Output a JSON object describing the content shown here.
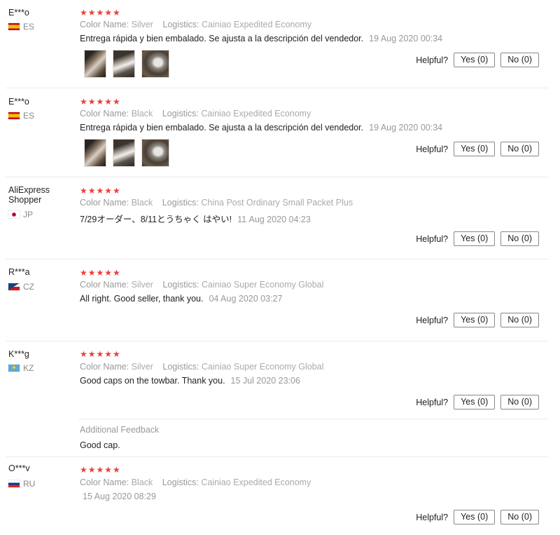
{
  "reviews": [
    {
      "name": "E***o",
      "country": "ES",
      "stars": "★★★★★",
      "color_key": "Color Name:",
      "color_val": "Silver",
      "log_key": "Logistics:",
      "log_val": "Cainiao Expedited Economy",
      "text": "Entrega rápida y bien embalado. Se ajusta a la descripción del vendedor.",
      "date": "19 Aug 2020 00:34",
      "helpful": "Helpful?",
      "yes": "Yes (0)",
      "no": "No (0)"
    },
    {
      "name": "E***o",
      "country": "ES",
      "stars": "★★★★★",
      "color_key": "Color Name:",
      "color_val": "Black",
      "log_key": "Logistics:",
      "log_val": "Cainiao Expedited Economy",
      "text": "Entrega rápida y bien embalado. Se ajusta a la descripción del vendedor.",
      "date": "19 Aug 2020 00:34",
      "helpful": "Helpful?",
      "yes": "Yes (0)",
      "no": "No (0)"
    },
    {
      "name_line1": "AliExpress",
      "name_line2": "Shopper",
      "country": "JP",
      "stars": "★★★★★",
      "color_key": "Color Name:",
      "color_val": "Black",
      "log_key": "Logistics:",
      "log_val": "China Post Ordinary Small Packet Plus",
      "text": "7/29オーダー、8/11とうちゃく はやい!",
      "date": "11 Aug 2020 04:23",
      "helpful": "Helpful?",
      "yes": "Yes (0)",
      "no": "No (0)"
    },
    {
      "name": "R***a",
      "country": "CZ",
      "stars": "★★★★★",
      "color_key": "Color Name:",
      "color_val": "Silver",
      "log_key": "Logistics:",
      "log_val": "Cainiao Super Economy Global",
      "text": "All right. Good seller, thank you.",
      "date": "04 Aug 2020 03:27",
      "helpful": "Helpful?",
      "yes": "Yes (0)",
      "no": "No (0)"
    },
    {
      "name": "K***g",
      "country": "KZ",
      "stars": "★★★★★",
      "color_key": "Color Name:",
      "color_val": "Silver",
      "log_key": "Logistics:",
      "log_val": "Cainiao Super Economy Global",
      "text": "Good caps on the towbar. Thank you.",
      "date": "15 Jul 2020 23:06",
      "helpful": "Helpful?",
      "yes": "Yes (0)",
      "no": "No (0)",
      "additional_title": "Additional Feedback",
      "additional_text": "Good cap."
    },
    {
      "name": "O***v",
      "country": "RU",
      "stars": "★★★★★",
      "color_key": "Color Name:",
      "color_val": "Black",
      "log_key": "Logistics:",
      "log_val": "Cainiao Expedited Economy",
      "date": "15 Aug 2020 08:29",
      "helpful": "Helpful?",
      "yes": "Yes (0)",
      "no": "No (0)"
    }
  ],
  "colors": {
    "star": "#e8413b",
    "muted": "#999999"
  }
}
